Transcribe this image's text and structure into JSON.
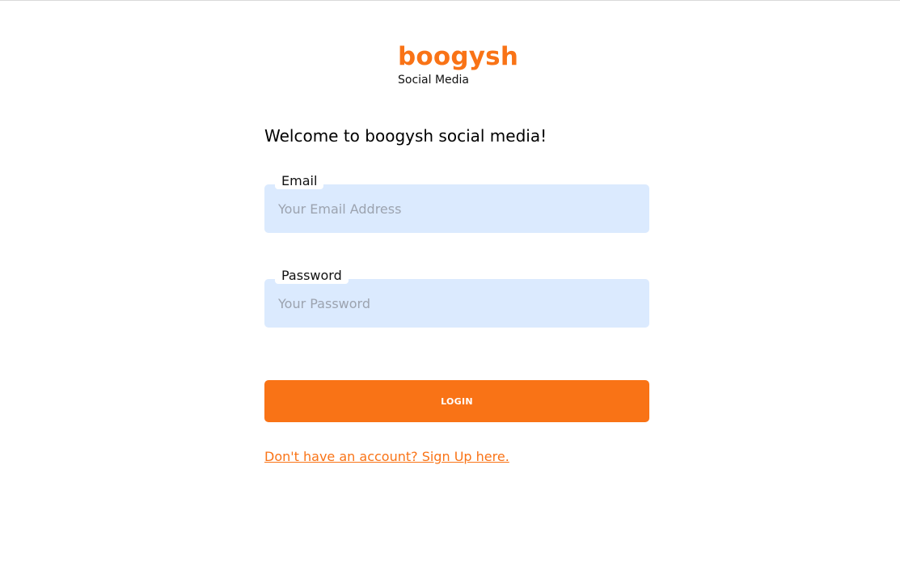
{
  "brand": {
    "name": "boogysh",
    "subtitle": "Social Media"
  },
  "welcome": "Welcome to boogysh social media!",
  "form": {
    "email": {
      "label": "Email",
      "placeholder": "Your Email Address",
      "value": ""
    },
    "password": {
      "label": "Password",
      "placeholder": "Your Password",
      "value": ""
    },
    "login_label": "LOGIN"
  },
  "signup_link": "Don't have an account? Sign Up here.",
  "colors": {
    "accent": "#f97316",
    "input_background": "#dbeafe",
    "placeholder": "#9ca3af"
  }
}
